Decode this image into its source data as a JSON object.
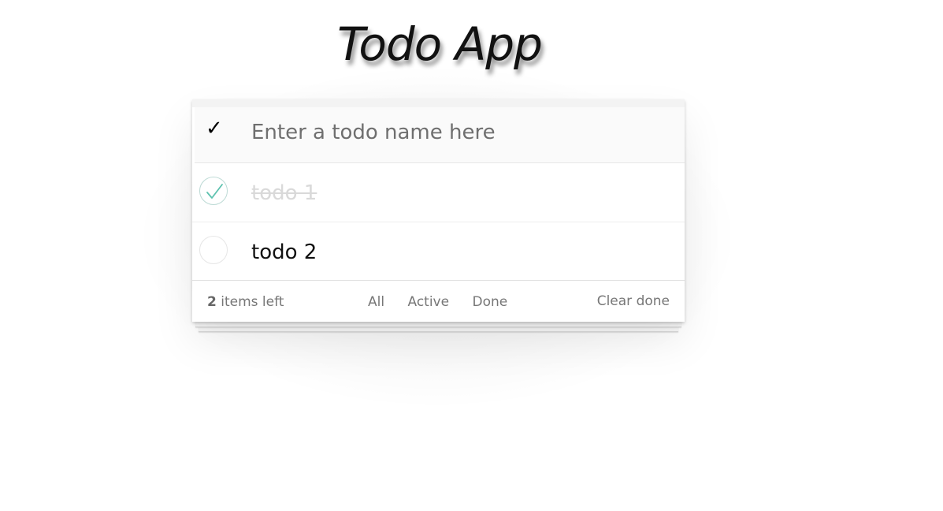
{
  "app": {
    "title": "Todo App"
  },
  "new_todo": {
    "toggle_all_glyph": "✓",
    "placeholder": "Enter a todo name here",
    "value": ""
  },
  "todos": [
    {
      "label": "todo 1",
      "completed": true
    },
    {
      "label": "todo 2",
      "completed": false
    }
  ],
  "footer": {
    "count": "2",
    "count_suffix": " items left",
    "filters": [
      "All",
      "Active",
      "Done"
    ],
    "clear_label": "Clear done"
  },
  "colors": {
    "check_accent": "#5dc2af",
    "completed_text": "#d9d9d9",
    "footer_text": "#777777"
  }
}
